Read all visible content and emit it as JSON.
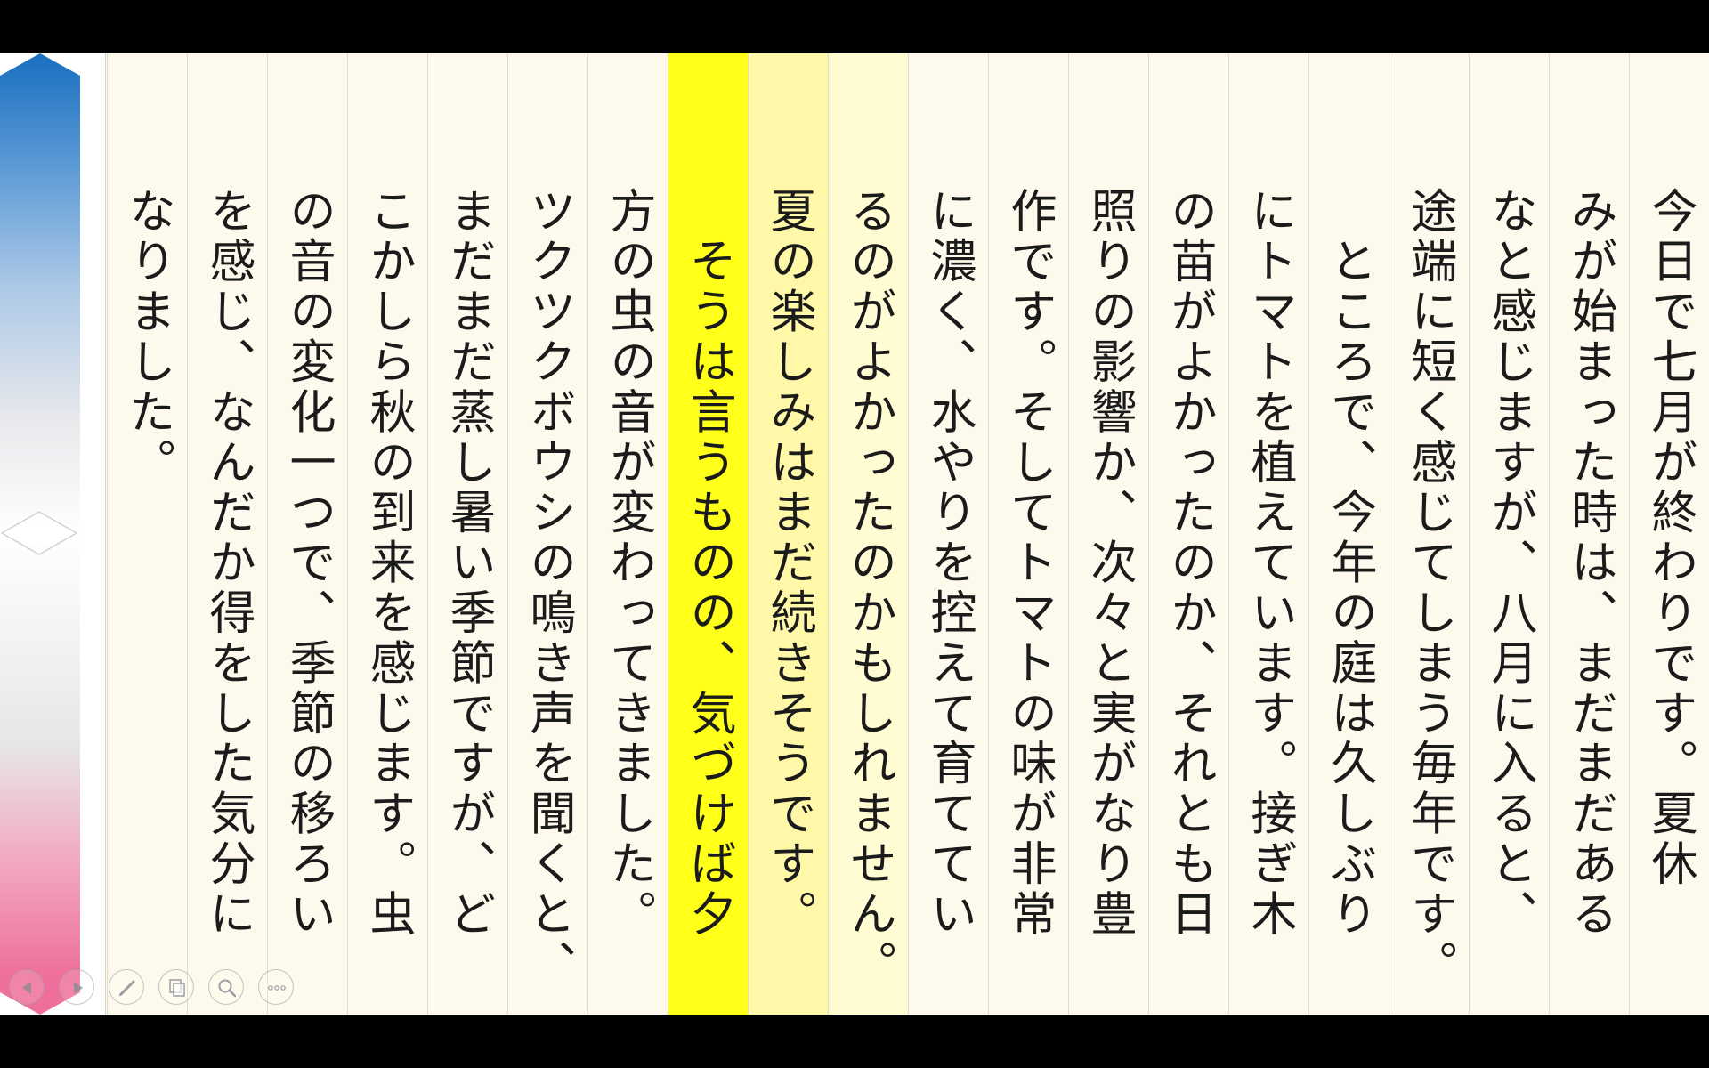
{
  "document": {
    "lines": [
      "今日で七月が終わりです。夏休",
      "みが始まった時は、まだまだある",
      "なと感じますが、八月に入ると、",
      "途端に短く感じてしまう毎年です。",
      "　ところで、今年の庭は久しぶり",
      "にトマトを植えています。接ぎ木",
      "の苗がよかったのか、それとも日",
      "照りの影響か、次々と実がなり豊",
      "作です。そしてトマトの味が非常",
      "に濃く、水やりを控えて育ててい",
      "るのがよかったのかもしれません。",
      "夏の楽しみはまだ続きそうです。",
      "　そうは言うものの、気づけば夕",
      "方の虫の音が変わってきました。",
      "ツクツクボウシの鳴き声を聞くと、",
      "まだまだ蒸し暑い季節ですが、ど",
      "こかしら秋の到来を感じます。虫",
      "の音の変化一つで、季節の移ろい",
      "を感じ、なんだか得をした気分に",
      "なりました。"
    ],
    "highlighted_line_index": 12
  },
  "colors": {
    "paper": "#fdf9ec",
    "highlight_current": "#ffff1a",
    "highlight_near": "#fff8a8",
    "highlight_far": "#fffbd2",
    "slider_top": "#1a6fc0",
    "slider_bottom": "#ee6f9b"
  },
  "toolbar": {
    "buttons": [
      {
        "name": "prev-page-button",
        "icon": "triangle-left-icon"
      },
      {
        "name": "next-page-button",
        "icon": "triangle-right-icon"
      },
      {
        "name": "pen-tool-button",
        "icon": "pen-icon"
      },
      {
        "name": "pages-button",
        "icon": "pages-icon"
      },
      {
        "name": "zoom-button",
        "icon": "magnifier-icon"
      },
      {
        "name": "more-options-button",
        "icon": "ellipsis-icon"
      }
    ]
  }
}
